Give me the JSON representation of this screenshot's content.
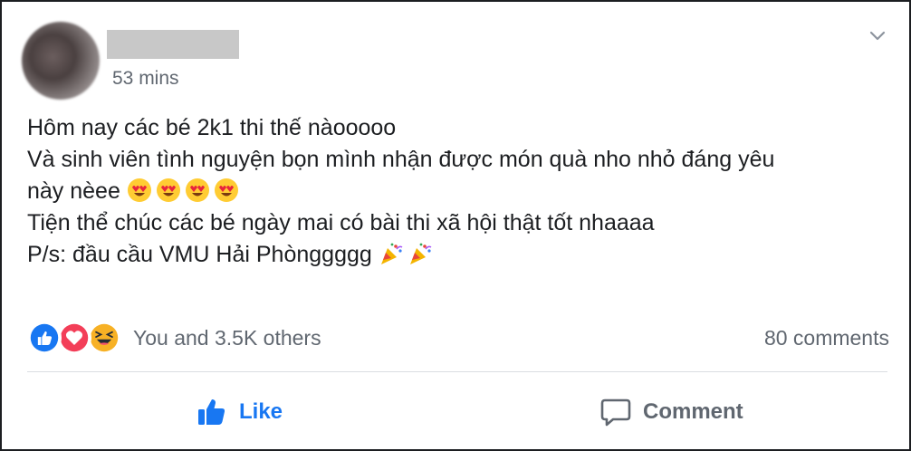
{
  "post": {
    "time": "53 mins",
    "lines": [
      "Hôm nay các bé 2k1 thi thế nàooooo",
      "Và sinh viên tình nguyện bọn mình nhận được món quà nho nhỏ đáng yêu",
      "này nèee",
      "Tiện thể chúc các bé ngày mai có bài thi xã hội thật tốt nhaaaa",
      "P/s: đầu cầu VMU Hải Phònggggg"
    ],
    "emoji_line3": [
      "heart-eyes-emoji",
      "heart-eyes-emoji",
      "heart-eyes-emoji",
      "heart-eyes-emoji"
    ],
    "emoji_line5": [
      "party-popper-emoji",
      "party-popper-emoji"
    ]
  },
  "stats": {
    "reactions_text": "You and 3.5K others",
    "reaction_icons": [
      "like-reaction-icon",
      "love-reaction-icon",
      "haha-reaction-icon"
    ],
    "comments_text": "80 comments"
  },
  "actions": {
    "like_label": "Like",
    "comment_label": "Comment"
  },
  "colors": {
    "like_blue": "#1877f2",
    "love_red": "#f33e58",
    "haha_yellow": "#f7b125",
    "secondary_text": "#606770"
  }
}
